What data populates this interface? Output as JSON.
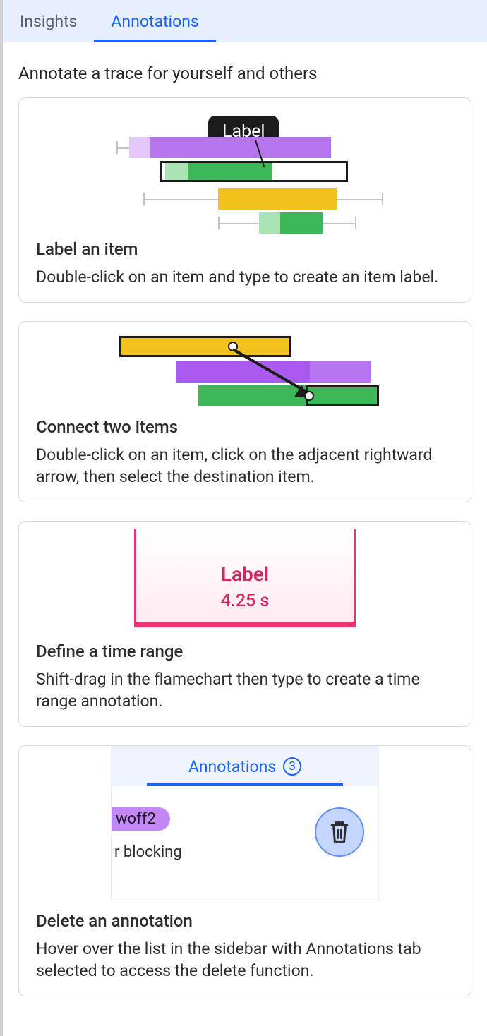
{
  "tabs": {
    "insights": "Insights",
    "annotations": "Annotations"
  },
  "intro": "Annotate a trace for yourself and others",
  "card1": {
    "tooltip": "Label",
    "title": "Label an item",
    "desc": "Double-click on an item and type to create an item label."
  },
  "card2": {
    "title": "Connect two items",
    "desc": "Double-click on an item, click on the adjacent rightward arrow, then select the destination item."
  },
  "card3": {
    "label": "Label",
    "time": "4.25 s",
    "title": "Define a time range",
    "desc": "Shift-drag in the flamechart then type to create a time range annotation."
  },
  "card4": {
    "tab_label": "Annotations",
    "badge": "3",
    "pill": "woff2",
    "line": "r blocking",
    "title": "Delete an annotation",
    "desc": "Hover over the list in the sidebar with Annotations tab selected to access the delete function."
  }
}
